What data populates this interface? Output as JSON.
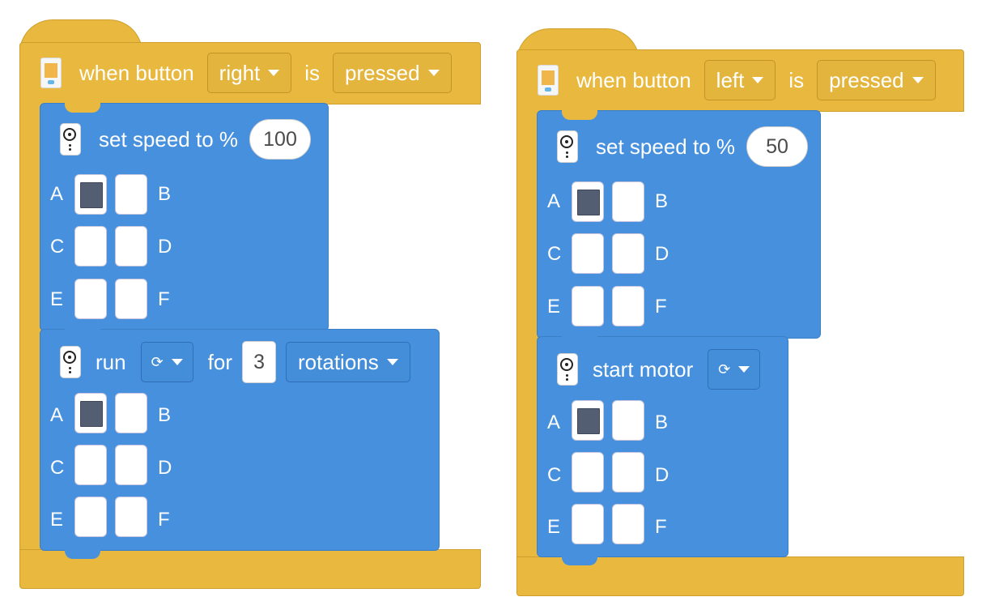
{
  "stacks": [
    {
      "hat": {
        "label": "when button",
        "button": "right",
        "is_label": "is",
        "state": "pressed",
        "icon": "hub-icon"
      },
      "blocks": [
        {
          "text": "set speed to %",
          "value": "100",
          "icon": "motor-icon",
          "ports": {
            "A": true,
            "B": false,
            "C": false,
            "D": false,
            "E": false,
            "F": false
          }
        },
        {
          "text": "run",
          "direction": "⟳",
          "for_label": "for",
          "count": "3",
          "unit": "rotations",
          "icon": "motor-icon",
          "ports": {
            "A": true,
            "B": false,
            "C": false,
            "D": false,
            "E": false,
            "F": false
          }
        }
      ]
    },
    {
      "hat": {
        "label": "when button",
        "button": "left",
        "is_label": "is",
        "state": "pressed",
        "icon": "hub-icon"
      },
      "blocks": [
        {
          "text": "set speed to %",
          "value": "50",
          "icon": "motor-icon",
          "ports": {
            "A": true,
            "B": false,
            "C": false,
            "D": false,
            "E": false,
            "F": false
          }
        },
        {
          "text": "start motor",
          "direction": "⟳",
          "icon": "motor-icon",
          "ports": {
            "A": true,
            "B": false,
            "C": false,
            "D": false,
            "E": false,
            "F": false
          }
        }
      ]
    }
  ],
  "port_labels": [
    "A",
    "B",
    "C",
    "D",
    "E",
    "F"
  ],
  "colors": {
    "event_yellow": "#e9b93f",
    "motor_blue": "#4690de",
    "selected_port": "#545e73"
  }
}
